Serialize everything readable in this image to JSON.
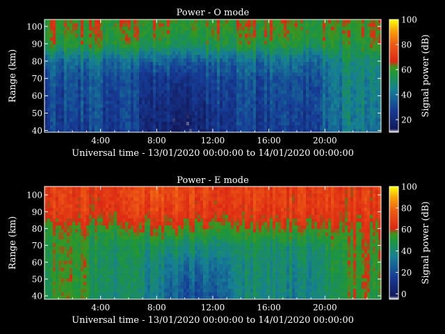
{
  "chart_data": [
    {
      "type": "heatmap",
      "title": "Power - O mode",
      "xlabel": "Universal time - 13/01/2020 00:00:00 to 14/01/2020 00:00:00",
      "ylabel": "Range (km)",
      "colorbar_label": "Signal power (dB)",
      "xlim": [
        0,
        24
      ],
      "ylim": [
        39,
        104
      ],
      "clim": [
        10,
        100
      ],
      "xticks": [
        "4:00",
        "8:00",
        "12:00",
        "16:00",
        "20:00"
      ],
      "yticks": [
        "40",
        "50",
        "60",
        "70",
        "80",
        "90",
        "100"
      ],
      "cbar_ticks": [
        "20",
        "40",
        "60",
        "80",
        "100"
      ],
      "x_hours": [
        0,
        2,
        4,
        6,
        8,
        10,
        12,
        14,
        16,
        18,
        20,
        22,
        24
      ],
      "y_km": [
        40,
        50,
        60,
        70,
        80,
        90,
        100
      ],
      "z_db": [
        [
          28,
          27,
          28,
          28,
          18,
          17,
          22,
          29,
          27,
          25,
          34,
          46,
          36
        ],
        [
          30,
          30,
          29,
          30,
          20,
          19,
          24,
          31,
          28,
          27,
          36,
          48,
          38
        ],
        [
          31,
          32,
          31,
          31,
          23,
          22,
          27,
          32,
          30,
          29,
          37,
          49,
          40
        ],
        [
          33,
          34,
          33,
          32,
          26,
          25,
          29,
          34,
          32,
          31,
          38,
          50,
          42
        ],
        [
          40,
          40,
          40,
          40,
          37,
          36,
          38,
          40,
          40,
          39,
          42,
          52,
          46
        ],
        [
          60,
          58,
          58,
          60,
          57,
          54,
          57,
          60,
          57,
          55,
          58,
          59,
          60
        ],
        [
          63,
          62,
          61,
          63,
          62,
          60,
          61,
          63,
          62,
          60,
          62,
          62,
          63
        ]
      ]
    },
    {
      "type": "heatmap",
      "title": "Power - E mode",
      "xlabel": "Universal time - 13/01/2020 00:00:00 to 14/01/2020 00:00:00",
      "ylabel": "Range (km)",
      "colorbar_label": "Signal power (dB)",
      "xlim": [
        0,
        24
      ],
      "ylim": [
        38,
        105
      ],
      "clim": [
        -5,
        100
      ],
      "xticks": [
        "4:00",
        "8:00",
        "12:00",
        "16:00",
        "20:00"
      ],
      "yticks": [
        "40",
        "50",
        "60",
        "70",
        "80",
        "90",
        "100"
      ],
      "cbar_ticks": [
        "0",
        "20",
        "40",
        "60",
        "80",
        "100"
      ],
      "x_hours": [
        0,
        2,
        4,
        6,
        8,
        10,
        12,
        14,
        16,
        18,
        20,
        22,
        24
      ],
      "y_km": [
        40,
        50,
        60,
        70,
        80,
        90,
        100
      ],
      "z_db": [
        [
          48,
          56,
          44,
          42,
          34,
          20,
          24,
          38,
          40,
          34,
          40,
          56,
          50
        ],
        [
          48,
          57,
          45,
          43,
          36,
          24,
          28,
          39,
          41,
          36,
          41,
          57,
          51
        ],
        [
          49,
          57,
          46,
          44,
          38,
          32,
          34,
          40,
          42,
          38,
          42,
          58,
          52
        ],
        [
          50,
          55,
          47,
          45,
          44,
          42,
          42,
          44,
          44,
          42,
          45,
          58,
          53
        ],
        [
          54,
          58,
          54,
          56,
          58,
          57,
          56,
          56,
          58,
          57,
          56,
          60,
          58
        ],
        [
          66,
          68,
          65,
          67,
          68,
          67,
          66,
          67,
          67,
          66,
          67,
          66,
          66
        ],
        [
          68,
          69,
          67,
          68,
          72,
          70,
          69,
          68,
          69,
          68,
          68,
          67,
          68
        ]
      ]
    }
  ]
}
